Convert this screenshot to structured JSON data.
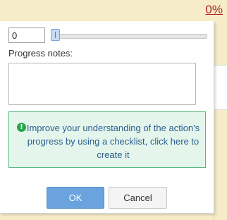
{
  "header": {
    "percent_link": "0%"
  },
  "progress": {
    "value": "0",
    "slider_percent": 0,
    "notes_label": "Progress notes:",
    "notes_value": ""
  },
  "info": {
    "icon": "info-icon",
    "message": "Improve your understanding of the action's progress by using a checklist, click here to create it"
  },
  "actions": {
    "ok_label": "OK",
    "cancel_label": "Cancel"
  }
}
